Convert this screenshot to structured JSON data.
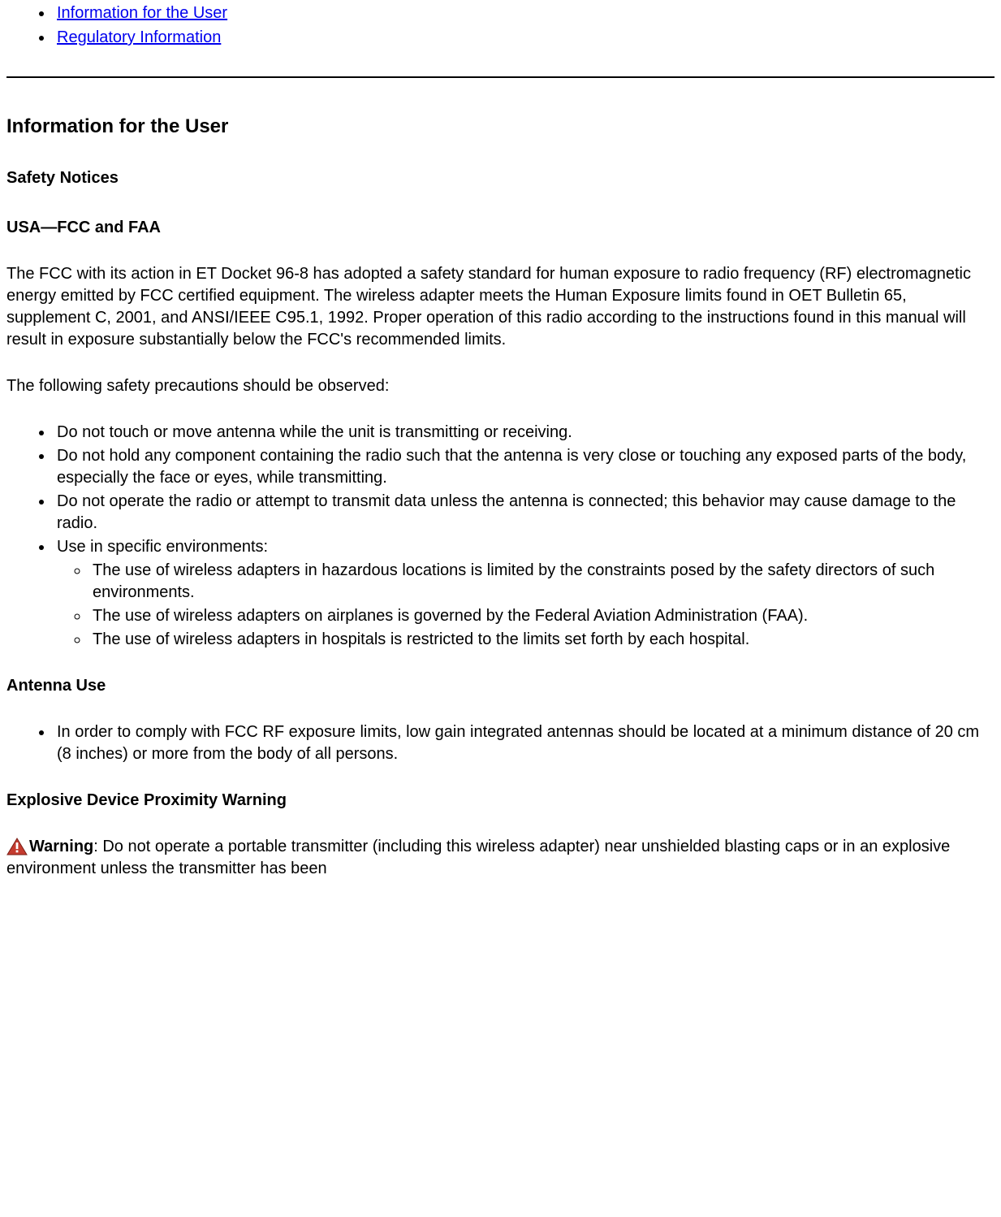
{
  "toc": {
    "items": [
      {
        "label": "Information for the User"
      },
      {
        "label": "Regulatory Information"
      }
    ]
  },
  "section": {
    "title": "Information for the User",
    "safety_title": "Safety Notices",
    "usa_title": "USA—FCC and FAA",
    "intro_para": "The FCC with its action in ET Docket 96-8 has adopted a safety standard for human exposure to radio frequency (RF) electromagnetic energy emitted by FCC certified equipment. The wireless adapter meets the Human Exposure limits found in OET Bulletin 65, supplement C, 2001, and ANSI/IEEE C95.1, 1992. Proper operation of this radio according to the instructions found in this manual will result in exposure substantially below the FCC's recommended limits.",
    "precautions_lead": "The following safety precautions should be observed:",
    "precautions": [
      "Do not touch or move antenna while the unit is transmitting or receiving.",
      "Do not hold any component containing the radio such that the antenna is very close or touching any exposed parts of the body, especially the face or eyes, while transmitting.",
      "Do not operate the radio or attempt to transmit data unless the antenna is connected; this behavior may cause damage to the radio.",
      "Use in specific environments:"
    ],
    "sub_env": [
      "The use of wireless adapters in hazardous locations is limited by the constraints posed by the safety directors of such environments.",
      "The use of wireless adapters on airplanes is governed by the Federal Aviation Administration (FAA).",
      "The use of wireless adapters in hospitals is restricted to the limits set forth by each hospital."
    ],
    "antenna_title": "Antenna Use",
    "antenna_items": [
      "In order to comply with FCC RF exposure limits, low gain integrated antennas should be located at a minimum distance of 20 cm (8 inches) or more from the body of all persons."
    ],
    "explosive_title": "Explosive Device Proximity Warning",
    "warning_label": "Warning",
    "warning_text": ": Do not operate a portable transmitter (including this wireless adapter) near unshielded blasting caps or in an explosive environment unless the transmitter has been"
  }
}
